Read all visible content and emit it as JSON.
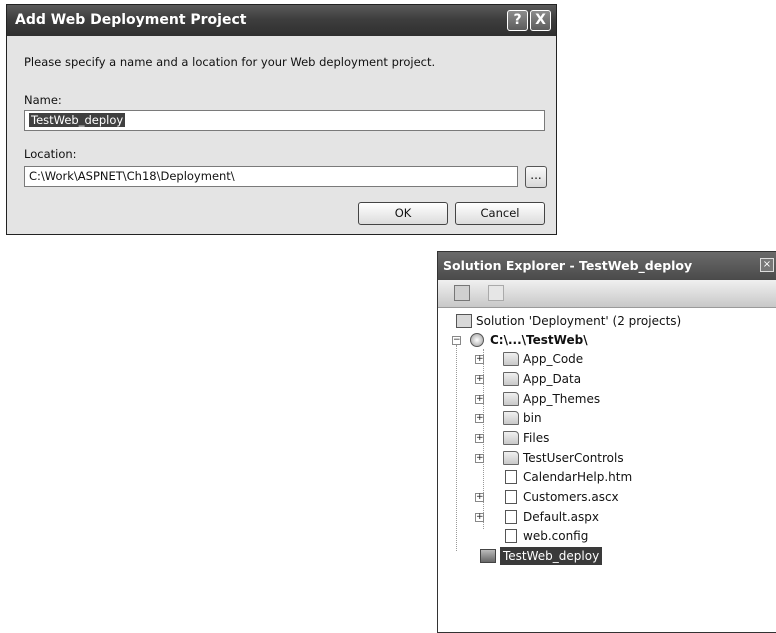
{
  "dialog": {
    "title": "Add Web Deployment Project",
    "help_label": "?",
    "close_label": "X",
    "description": "Please specify a name and a location for your Web deployment project.",
    "name_label": "Name:",
    "name_value": "TestWeb_deploy",
    "location_label": "Location:",
    "location_value": "C:\\Work\\ASPNET\\Ch18\\Deployment\\",
    "browse_label": "...",
    "ok_label": "OK",
    "cancel_label": "Cancel"
  },
  "solution_explorer": {
    "title": "Solution Explorer - TestWeb_deploy",
    "close_label": "×",
    "solution_label": "Solution 'Deployment' (2 projects)",
    "website_label": "C:\\...\\TestWeb\\",
    "items": [
      {
        "label": "App_Code",
        "icon": "app-code-folder-icon",
        "expandable": true
      },
      {
        "label": "App_Data",
        "icon": "app-data-folder-icon",
        "expandable": true
      },
      {
        "label": "App_Themes",
        "icon": "app-themes-folder-icon",
        "expandable": true
      },
      {
        "label": "bin",
        "icon": "bin-folder-icon",
        "expandable": true
      },
      {
        "label": "Files",
        "icon": "folder-icon",
        "expandable": true
      },
      {
        "label": "TestUserControls",
        "icon": "folder-icon",
        "expandable": true
      },
      {
        "label": "CalendarHelp.htm",
        "icon": "html-file-icon",
        "expandable": false
      },
      {
        "label": "Customers.ascx",
        "icon": "user-control-icon",
        "expandable": true
      },
      {
        "label": "Default.aspx",
        "icon": "web-form-icon",
        "expandable": true
      },
      {
        "label": "web.config",
        "icon": "config-file-icon",
        "expandable": false
      }
    ],
    "deploy_project_label": "TestWeb_deploy"
  }
}
